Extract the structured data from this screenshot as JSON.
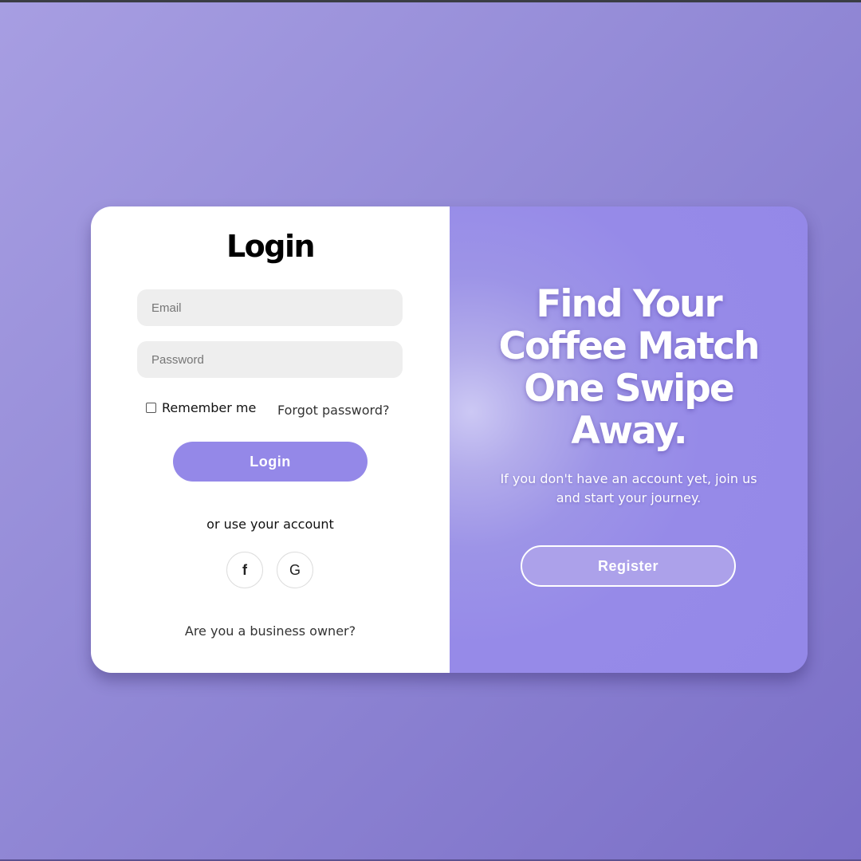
{
  "login": {
    "title": "Login",
    "email_placeholder": "Email",
    "password_placeholder": "Password",
    "remember_label": "Remember me",
    "remember_checked": false,
    "forgot_label": "Forgot password?",
    "login_button": "Login",
    "alt_text": "or use your account",
    "social": [
      {
        "icon": "facebook-icon",
        "glyph": "f"
      },
      {
        "icon": "google-icon",
        "glyph": "G"
      }
    ],
    "business_link": "Are you a business owner?"
  },
  "promo": {
    "headline_lines": [
      "Find Your",
      "Coffee Match",
      "One Swipe",
      "Away."
    ],
    "subtext_lines": [
      "If you don't have an account yet, join us",
      "and start your journey."
    ],
    "register_button": "Register"
  },
  "colors": {
    "accent": "#9488e8",
    "background": "#9289d6",
    "card": "#ffffff",
    "input_bg": "#eeeeee"
  }
}
